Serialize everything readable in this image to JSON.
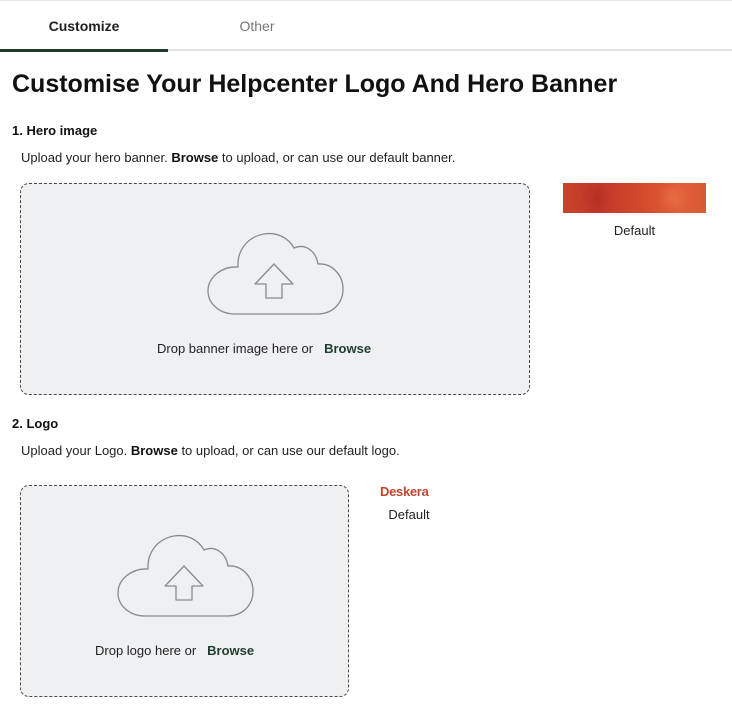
{
  "tabs": [
    {
      "label": "Customize",
      "active": true
    },
    {
      "label": "Other",
      "active": false
    }
  ],
  "page_title": "Customise Your Helpcenter Logo And Hero Banner",
  "hero": {
    "section_title": "1. Hero image",
    "desc_prefix": "Upload your hero banner. ",
    "desc_browse": "Browse",
    "desc_suffix": " to upload, or can use our default banner.",
    "drop_text": "Drop banner image here or",
    "browse_label": "Browse",
    "default_label": "Default"
  },
  "logo": {
    "section_title": "2. Logo",
    "desc_prefix": "Upload your Logo. ",
    "desc_browse": "Browse",
    "desc_suffix": " to upload, or can use our default logo.",
    "drop_text": "Drop logo here or",
    "browse_label": "Browse",
    "default_logo_text": "Deskera",
    "default_label": "Default"
  },
  "colors": {
    "accent": "#1f3d2c",
    "dropzone_bg": "#eff0f2",
    "logo_red": "#c6442e"
  },
  "icons": {
    "upload": "cloud-upload-icon"
  }
}
